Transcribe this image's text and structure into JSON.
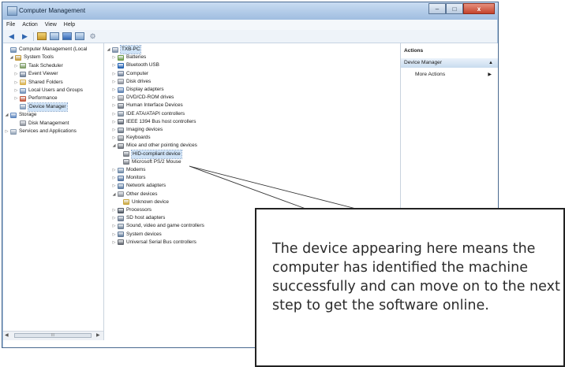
{
  "window": {
    "title": "Computer Management",
    "controls": {
      "minimize": "–",
      "maximize": "□",
      "close": "x"
    }
  },
  "menubar": [
    "File",
    "Action",
    "View",
    "Help"
  ],
  "toolbar": {
    "back": "◀",
    "forward": "▶"
  },
  "left_tree": [
    {
      "label": "Computer Management (Local",
      "indent": 0,
      "expander": "",
      "icon": "computer-management-icon",
      "color": "#6c8db3"
    },
    {
      "label": "System Tools",
      "indent": 1,
      "expander": "◢",
      "icon": "tools-icon",
      "color": "#c39a3d"
    },
    {
      "label": "Task Scheduler",
      "indent": 2,
      "expander": "▷",
      "icon": "clock-icon",
      "color": "#7d9c63"
    },
    {
      "label": "Event Viewer",
      "indent": 2,
      "expander": "▷",
      "icon": "event-viewer-icon",
      "color": "#6f7f96"
    },
    {
      "label": "Shared Folders",
      "indent": 2,
      "expander": "▷",
      "icon": "folder-icon",
      "color": "#d9b14b"
    },
    {
      "label": "Local Users and Groups",
      "indent": 2,
      "expander": "▷",
      "icon": "users-icon",
      "color": "#6f8fb8"
    },
    {
      "label": "Performance",
      "indent": 2,
      "expander": "▷",
      "icon": "performance-icon",
      "color": "#c2553a"
    },
    {
      "label": "Device Manager",
      "indent": 2,
      "expander": "",
      "icon": "device-manager-icon",
      "color": "#7f98b8",
      "selected": true
    },
    {
      "label": "Storage",
      "indent": 0,
      "expander": "◢",
      "icon": "storage-icon",
      "color": "#5d86bf"
    },
    {
      "label": "Disk Management",
      "indent": 2,
      "expander": "",
      "icon": "disk-icon",
      "color": "#8a8f98"
    },
    {
      "label": "Services and Applications",
      "indent": 0,
      "expander": "▷",
      "icon": "services-icon",
      "color": "#8fa0b4"
    }
  ],
  "device_tree": [
    {
      "label": "TXB-PC",
      "indent": 0,
      "expander": "◢",
      "icon": "computer-icon",
      "color": "#7c8fa8",
      "selected": true
    },
    {
      "label": "Batteries",
      "indent": 1,
      "expander": "▷",
      "icon": "battery-icon",
      "color": "#6b9a4a"
    },
    {
      "label": "Bluetooth USB",
      "indent": 1,
      "expander": "▷",
      "icon": "bluetooth-icon",
      "color": "#1f5fb0"
    },
    {
      "label": "Computer",
      "indent": 1,
      "expander": "▷",
      "icon": "computer-icon",
      "color": "#6f7f96"
    },
    {
      "label": "Disk drives",
      "indent": 1,
      "expander": "▷",
      "icon": "disk-drive-icon",
      "color": "#8a8f98"
    },
    {
      "label": "Display adapters",
      "indent": 1,
      "expander": "▷",
      "icon": "display-adapter-icon",
      "color": "#5a7fb0"
    },
    {
      "label": "DVD/CD-ROM drives",
      "indent": 1,
      "expander": "▷",
      "icon": "dvd-icon",
      "color": "#8c9097"
    },
    {
      "label": "Human Interface Devices",
      "indent": 1,
      "expander": "▷",
      "icon": "hid-icon",
      "color": "#6c7480"
    },
    {
      "label": "IDE ATA/ATAPI controllers",
      "indent": 1,
      "expander": "▷",
      "icon": "ide-controller-icon",
      "color": "#7d8a99"
    },
    {
      "label": "IEEE 1394 Bus host controllers",
      "indent": 1,
      "expander": "▷",
      "icon": "ieee1394-icon",
      "color": "#5f6772"
    },
    {
      "label": "Imaging devices",
      "indent": 1,
      "expander": "▷",
      "icon": "camera-icon",
      "color": "#6a7684"
    },
    {
      "label": "Keyboards",
      "indent": 1,
      "expander": "▷",
      "icon": "keyboard-icon",
      "color": "#7a8088"
    },
    {
      "label": "Mice and other pointing devices",
      "indent": 1,
      "expander": "◢",
      "icon": "mouse-icon",
      "color": "#6a6f78"
    },
    {
      "label": "HID-compliant device",
      "indent": 2,
      "expander": "",
      "icon": "mouse-icon",
      "color": "#777c84",
      "selected": true
    },
    {
      "label": "Microsoft PS/2 Mouse",
      "indent": 2,
      "expander": "",
      "icon": "mouse-icon",
      "color": "#777c84"
    },
    {
      "label": "Modems",
      "indent": 1,
      "expander": "▷",
      "icon": "modem-icon",
      "color": "#6f8aa8"
    },
    {
      "label": "Monitors",
      "indent": 1,
      "expander": "▷",
      "icon": "monitor-icon",
      "color": "#4f6f9c"
    },
    {
      "label": "Network adapters",
      "indent": 1,
      "expander": "▷",
      "icon": "network-icon",
      "color": "#5b7a9e"
    },
    {
      "label": "Other devices",
      "indent": 1,
      "expander": "◢",
      "icon": "other-devices-icon",
      "color": "#8a8f98"
    },
    {
      "label": "Unknown device",
      "indent": 2,
      "expander": "",
      "icon": "unknown-device-icon",
      "color": "#c9a53a"
    },
    {
      "label": "Processors",
      "indent": 1,
      "expander": "▷",
      "icon": "processor-icon",
      "color": "#4c5560"
    },
    {
      "label": "SD host adapters",
      "indent": 1,
      "expander": "▷",
      "icon": "sd-adapter-icon",
      "color": "#6a7a90"
    },
    {
      "label": "Sound, video and game controllers",
      "indent": 1,
      "expander": "▷",
      "icon": "sound-icon",
      "color": "#6c7f94"
    },
    {
      "label": "System devices",
      "indent": 1,
      "expander": "▷",
      "icon": "system-devices-icon",
      "color": "#5f7896"
    },
    {
      "label": "Universal Serial Bus controllers",
      "indent": 1,
      "expander": "▷",
      "icon": "usb-icon",
      "color": "#5f646c"
    }
  ],
  "actions": {
    "header": "Actions",
    "section": "Device Manager",
    "section_arrow": "▲",
    "more": "More Actions",
    "more_arrow": "▶"
  },
  "left_scroll": {
    "left": "◀",
    "right": "▶",
    "thumb": "III"
  },
  "callout": {
    "text": "The device appearing here means the computer has identified the machine successfully and can move on to the next step to get the software online."
  }
}
